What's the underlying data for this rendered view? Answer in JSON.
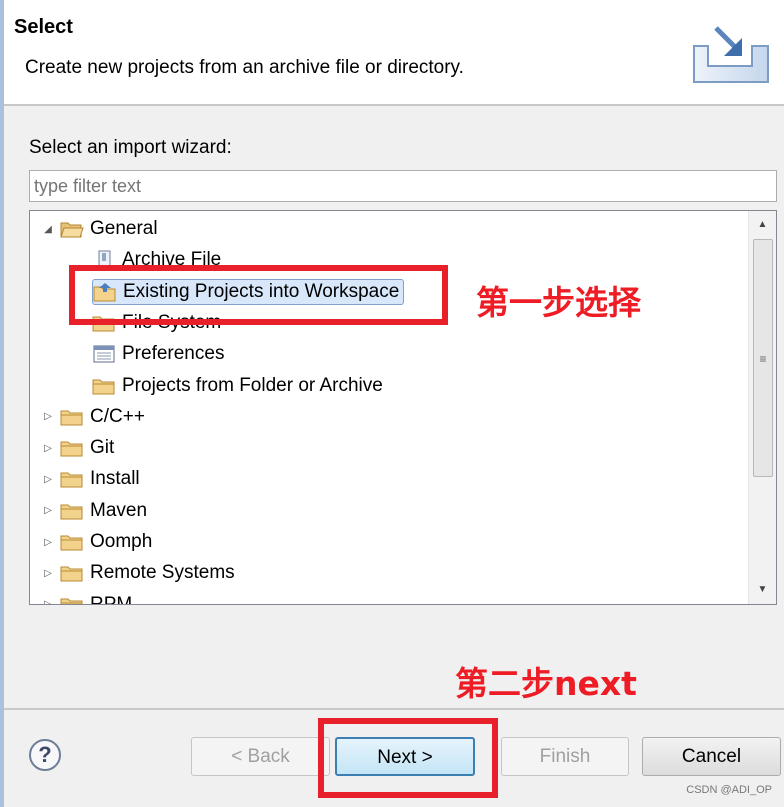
{
  "header": {
    "title": "Select",
    "description": "Create new projects from an archive file or directory.",
    "icon": "import-wizard-banner-icon"
  },
  "wizard_label": "Select an import wizard:",
  "filter": {
    "placeholder": "type filter text",
    "value": ""
  },
  "tree": [
    {
      "label": "General",
      "level": 0,
      "expanded": true,
      "icon": "folder-open-icon"
    },
    {
      "label": "Archive File",
      "level": 1,
      "icon": "archive-file-icon"
    },
    {
      "label": "Existing Projects into Workspace",
      "level": 1,
      "icon": "existing-projects-icon",
      "selected": true
    },
    {
      "label": "File System",
      "level": 1,
      "icon": "folder-icon"
    },
    {
      "label": "Preferences",
      "level": 1,
      "icon": "preferences-icon"
    },
    {
      "label": "Projects from Folder or Archive",
      "level": 1,
      "icon": "folder-icon"
    },
    {
      "label": "C/C++",
      "level": 0,
      "expanded": false,
      "icon": "folder-icon"
    },
    {
      "label": "Git",
      "level": 0,
      "expanded": false,
      "icon": "folder-icon"
    },
    {
      "label": "Install",
      "level": 0,
      "expanded": false,
      "icon": "folder-icon"
    },
    {
      "label": "Maven",
      "level": 0,
      "expanded": false,
      "icon": "folder-icon"
    },
    {
      "label": "Oomph",
      "level": 0,
      "expanded": false,
      "icon": "folder-icon"
    },
    {
      "label": "Remote Systems",
      "level": 0,
      "expanded": false,
      "icon": "folder-icon"
    },
    {
      "label": "RPM",
      "level": 0,
      "expanded": false,
      "icon": "folder-icon"
    }
  ],
  "buttons": {
    "help": "?",
    "back": "< Back",
    "next": "Next >",
    "finish": "Finish",
    "cancel": "Cancel"
  },
  "annotations": {
    "step1": "第一步选择",
    "step2": "第二步next",
    "color": "#ee1c25"
  },
  "watermark": "CSDN @ADI_OP"
}
